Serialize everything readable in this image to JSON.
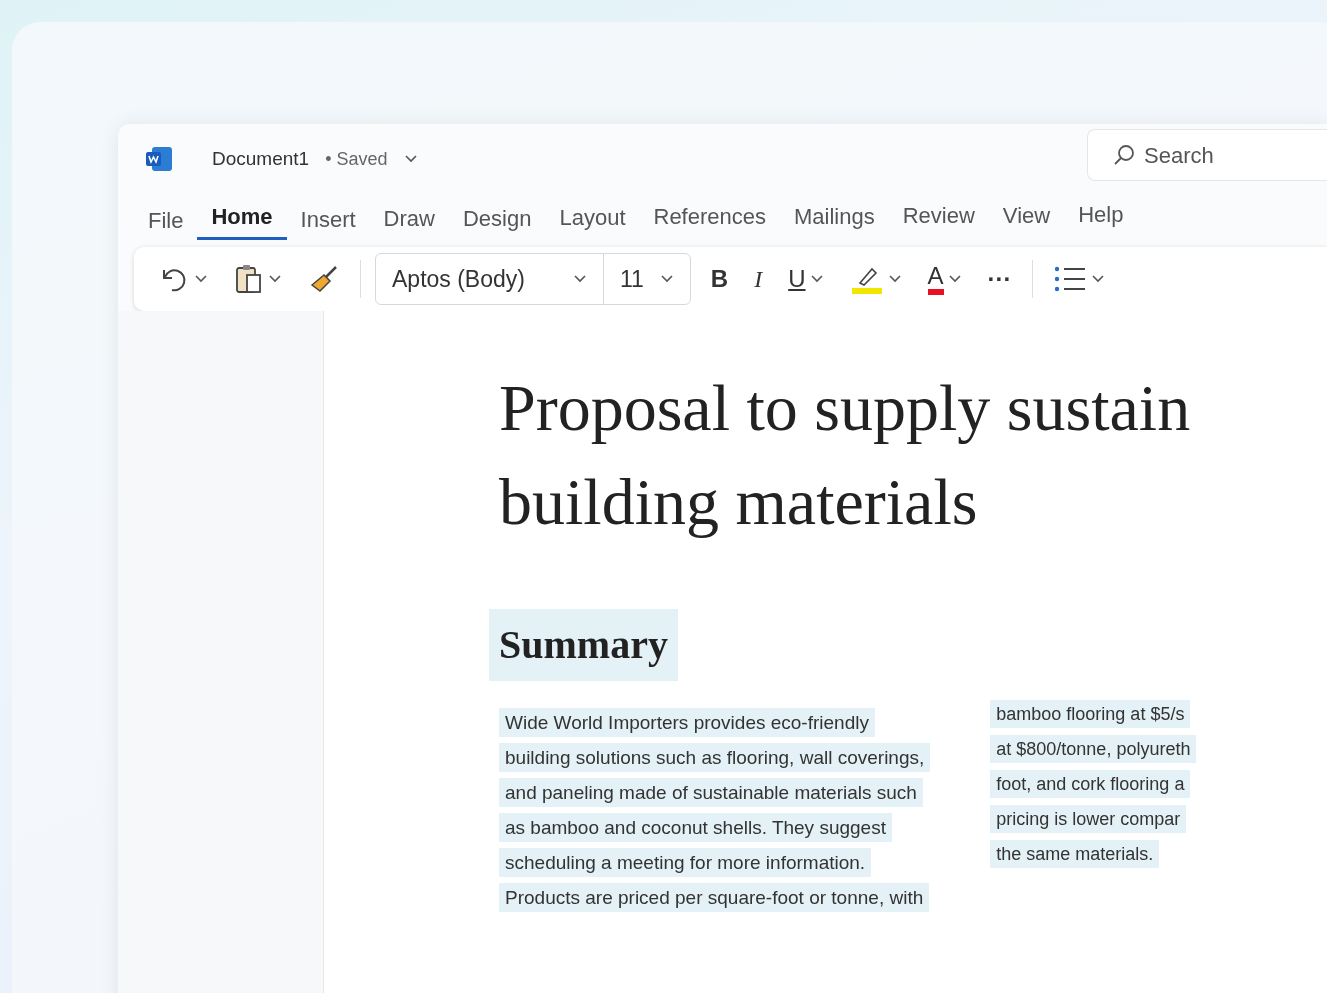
{
  "window": {
    "title": "Document1",
    "status": "• Saved"
  },
  "search": {
    "placeholder": "Search"
  },
  "tabs": [
    {
      "label": "File",
      "selected": false
    },
    {
      "label": "Home",
      "selected": true
    },
    {
      "label": "Insert",
      "selected": false
    },
    {
      "label": "Draw",
      "selected": false
    },
    {
      "label": "Design",
      "selected": false
    },
    {
      "label": "Layout",
      "selected": false
    },
    {
      "label": "References",
      "selected": false
    },
    {
      "label": "Mailings",
      "selected": false
    },
    {
      "label": "Review",
      "selected": false
    },
    {
      "label": "View",
      "selected": false
    },
    {
      "label": "Help",
      "selected": false
    }
  ],
  "toolbar": {
    "font": "Aptos (Body)",
    "size": "11",
    "bold": "B",
    "italic": "I",
    "underline": "U",
    "font_color": "A",
    "more": "···"
  },
  "document": {
    "title_lines": [
      "Proposal to supply sustain",
      "building materials"
    ],
    "heading": "Summary",
    "columns": [
      [
        "Wide World Importers provides eco-friendly",
        "building solutions such as flooring, wall coverings,",
        "and paneling made of sustainable materials such",
        "as bamboo and coconut shells. They suggest",
        "scheduling a meeting for more information.",
        "Products are priced per square-foot or tonne, with"
      ],
      [
        "bamboo flooring at $5/s",
        "at $800/tonne, polyureth",
        "foot, and cork flooring a",
        "pricing is lower compar",
        "the same materials."
      ]
    ]
  }
}
